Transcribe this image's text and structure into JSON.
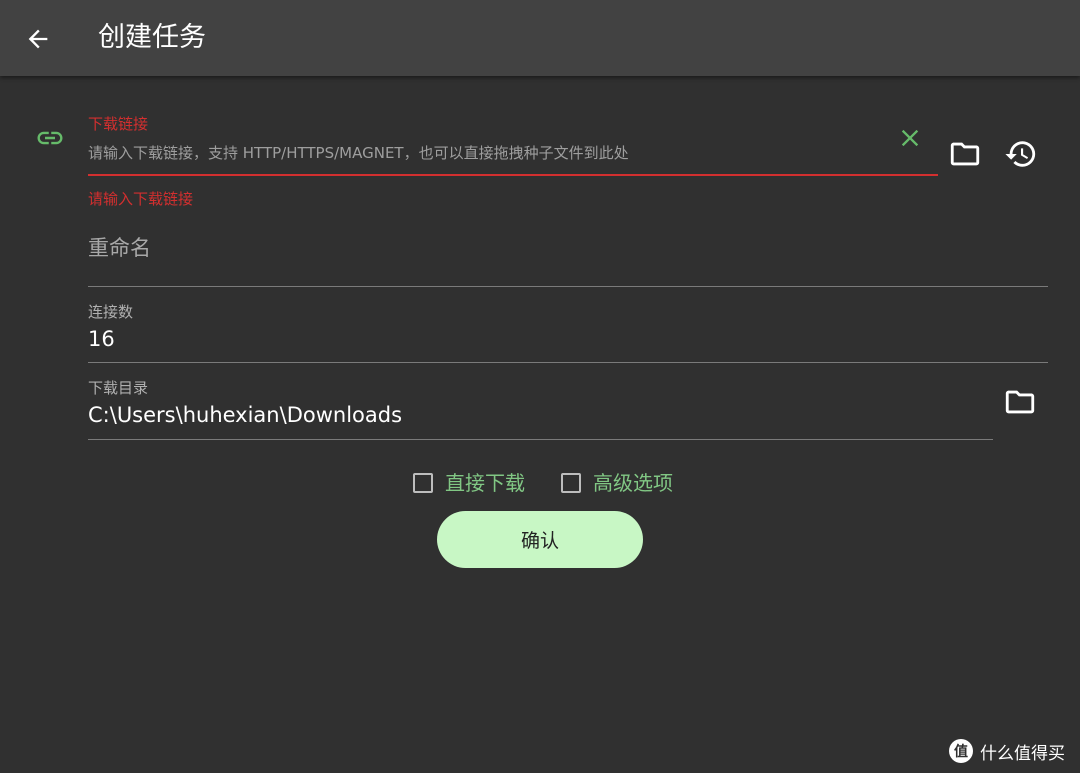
{
  "appbar": {
    "title": "创建任务",
    "back_icon": "arrow-back-icon"
  },
  "url_field": {
    "label": "下载链接",
    "placeholder": "请输入下载链接，支持 HTTP/HTTPS/MAGNET，也可以直接拖拽种子文件到此处",
    "error": "请输入下载链接",
    "leading_icon": "link-icon",
    "clear_icon": "close-icon",
    "folder_icon": "folder-icon",
    "history_icon": "history-icon"
  },
  "rename_field": {
    "placeholder": "重命名",
    "value": ""
  },
  "connections_field": {
    "label": "连接数",
    "value": "16"
  },
  "directory_field": {
    "label": "下载目录",
    "value": "C:\\Users\\huhexian\\Downloads",
    "folder_icon": "folder-icon"
  },
  "options": {
    "direct_download": {
      "label": "直接下载",
      "checked": false
    },
    "advanced": {
      "label": "高级选项",
      "checked": false
    }
  },
  "confirm_button": {
    "label": "确认"
  },
  "watermark": {
    "text": "什么值得买"
  },
  "colors": {
    "background": "#303030",
    "appbar": "#424242",
    "error": "#d32f2f",
    "accent_green": "#81c784",
    "button_bg": "#c8f7c5"
  }
}
